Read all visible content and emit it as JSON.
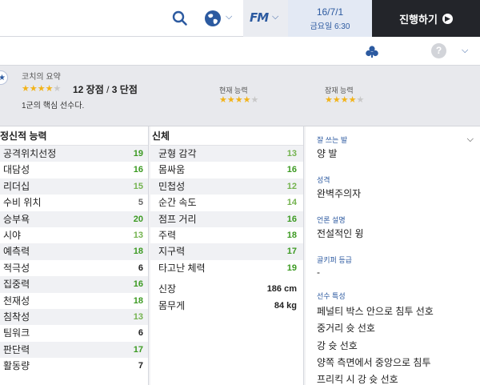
{
  "topbar": {
    "search_icon": "search-icon",
    "globe_icon": "globe-icon",
    "fm_logo": "FM",
    "date": "16/7/1",
    "day_time": "금요일 6:30",
    "continue_label": "진행하기"
  },
  "summary": {
    "title": "코치의 요약",
    "stars": 4.5,
    "strengths": "12 장점",
    "separator": " / ",
    "weaknesses": "3 단점",
    "description": "1군의 핵심 선수다.",
    "current_ability_label": "현재 능력",
    "current_ability_stars": 4.5,
    "potential_ability_label": "잠재 능력",
    "potential_ability_stars": 4.5
  },
  "mental": {
    "header": "정신적 능력",
    "attrs": [
      {
        "name": "공격위치선정",
        "value": "19",
        "color": "#3c9a22"
      },
      {
        "name": "대담성",
        "value": "16",
        "color": "#3c9a22"
      },
      {
        "name": "리더십",
        "value": "15",
        "color": "#74b34f"
      },
      {
        "name": "수비 위치",
        "value": "5",
        "color": "#666666"
      },
      {
        "name": "승부욕",
        "value": "20",
        "color": "#3c9a22"
      },
      {
        "name": "시야",
        "value": "13",
        "color": "#74b34f"
      },
      {
        "name": "예측력",
        "value": "18",
        "color": "#3c9a22"
      },
      {
        "name": "적극성",
        "value": "6",
        "color": "#222222"
      },
      {
        "name": "집중력",
        "value": "16",
        "color": "#3c9a22"
      },
      {
        "name": "천재성",
        "value": "18",
        "color": "#3c9a22"
      },
      {
        "name": "침착성",
        "value": "13",
        "color": "#74b34f"
      },
      {
        "name": "팀워크",
        "value": "6",
        "color": "#222222"
      },
      {
        "name": "판단력",
        "value": "17",
        "color": "#3c9a22"
      },
      {
        "name": "활동량",
        "value": "7",
        "color": "#222222"
      }
    ]
  },
  "physical": {
    "header": "신체",
    "attrs": [
      {
        "name": "균형 감각",
        "value": "13",
        "color": "#74b34f"
      },
      {
        "name": "몸싸움",
        "value": "16",
        "color": "#3c9a22"
      },
      {
        "name": "민첩성",
        "value": "12",
        "color": "#74b34f"
      },
      {
        "name": "순간 속도",
        "value": "14",
        "color": "#74b34f"
      },
      {
        "name": "점프 거리",
        "value": "16",
        "color": "#3c9a22"
      },
      {
        "name": "주력",
        "value": "18",
        "color": "#3c9a22"
      },
      {
        "name": "지구력",
        "value": "17",
        "color": "#3c9a22"
      },
      {
        "name": "타고난 체력",
        "value": "19",
        "color": "#3c9a22"
      }
    ],
    "height_label": "신장",
    "height_value": "186 cm",
    "weight_label": "몸무게",
    "weight_value": "84 kg"
  },
  "info": {
    "foot_label": "잘 쓰는 발",
    "foot_value": "양 발",
    "personality_label": "성격",
    "personality_value": "완벽주의자",
    "media_label": "언론 설명",
    "media_value": "전설적인 윙",
    "gk_label": "골키퍼 등급",
    "gk_value": "-",
    "traits_label": "선수 특성",
    "traits": [
      "페널티 박스 안으로 침투 선호",
      "중거리 슛 선호",
      "강 슛 선호",
      "양쪽 측면에서 중앙으로 침투",
      "프리킥 시 강 슛 선호"
    ]
  }
}
